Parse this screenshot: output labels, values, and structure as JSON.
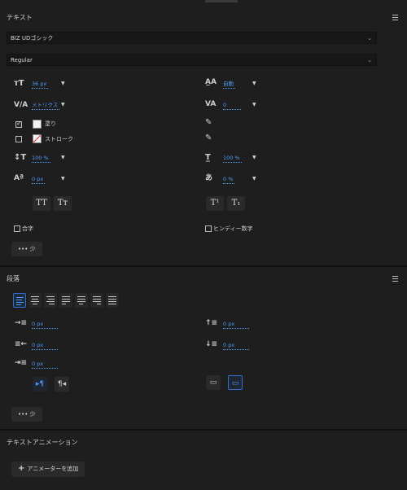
{
  "text_panel": {
    "title": "テキスト",
    "font_family": "BIZ UDゴシック",
    "font_style": "Regular",
    "font_size": "36 px",
    "leading": "自動",
    "kerning": "メトリクス",
    "tracking": "0",
    "fill_label": "塗り",
    "stroke_label": "ストローク",
    "vertical_scale": "100 %",
    "horizontal_scale": "100 %",
    "baseline_shift": "0 px",
    "tsume": "0 %",
    "allcaps_label": "TT",
    "smallcaps_label": "Tт",
    "superscript_label": "T¹",
    "subscript_label": "T₁",
    "ligature_label": "合字",
    "hindi_digits_label": "ヒンディー数字",
    "more_label": "••• 少"
  },
  "paragraph_panel": {
    "title": "段落",
    "indent_left": "0 px",
    "indent_first": "0 px",
    "indent_right": "0 px",
    "space_before": "0 px",
    "space_after": "0 px",
    "more_label": "••• 少"
  },
  "animation_panel": {
    "title": "テキストアニメーション",
    "add_button": "アニメーターを追加",
    "add_icon": "+"
  },
  "colors": {
    "accent": "#4f9cf6",
    "background": "#1e1e1e"
  }
}
